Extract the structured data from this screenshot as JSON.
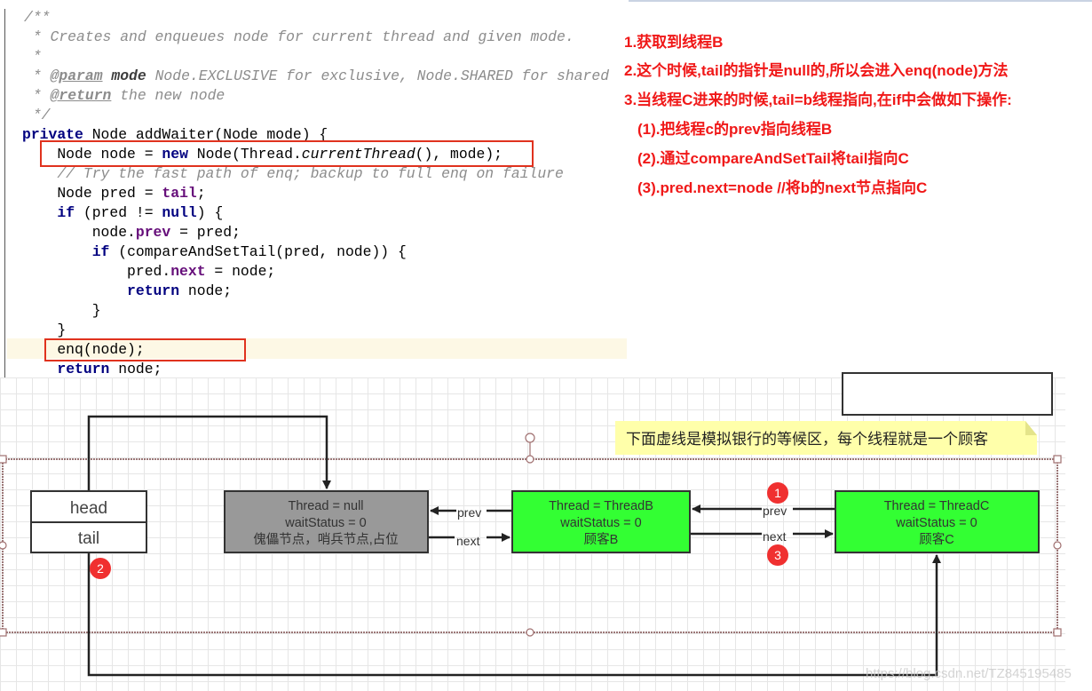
{
  "code": {
    "lines": [
      [
        [
          "/**",
          "cm"
        ]
      ],
      [
        [
          " * Creates and enqueues node for current thread and given mode.",
          "cm"
        ]
      ],
      [
        [
          " *",
          "cm"
        ]
      ],
      [
        [
          " * ",
          "cm"
        ],
        [
          "@param",
          "tag"
        ],
        [
          " mode",
          "pn"
        ],
        [
          " Node.EXCLUSIVE for exclusive, Node.SHARED for shared",
          "cm"
        ]
      ],
      [
        [
          " * ",
          "cm"
        ],
        [
          "@return",
          "tag"
        ],
        [
          " the new node",
          "cm"
        ]
      ],
      [
        [
          " */",
          "cm"
        ]
      ],
      [
        [
          "private",
          "kw"
        ],
        [
          " Node addWaiter(Node mode) {",
          ""
        ]
      ],
      [
        [
          "    Node node = ",
          ""
        ],
        [
          "new",
          "kw"
        ],
        [
          " Node(Thread.",
          ""
        ],
        [
          "currentThread",
          "it"
        ],
        [
          "(), mode);",
          ""
        ]
      ],
      [
        [
          "    // Try the fast path of enq; backup to full enq on failure",
          "cm"
        ]
      ],
      [
        [
          "    Node pred = ",
          ""
        ],
        [
          "tail",
          "fld"
        ],
        [
          ";",
          ""
        ]
      ],
      [
        [
          "    ",
          ""
        ],
        [
          "if",
          "kw"
        ],
        [
          " (pred != ",
          ""
        ],
        [
          "null",
          "kw"
        ],
        [
          ") {",
          ""
        ]
      ],
      [
        [
          "        node.",
          ""
        ],
        [
          "prev",
          "fld"
        ],
        [
          " = pred;",
          ""
        ]
      ],
      [
        [
          "        ",
          ""
        ],
        [
          "if",
          "kw"
        ],
        [
          " (compareAndSetTail(pred, node)) {",
          ""
        ]
      ],
      [
        [
          "            pred.",
          ""
        ],
        [
          "next",
          "fld"
        ],
        [
          " = node;",
          ""
        ]
      ],
      [
        [
          "            ",
          ""
        ],
        [
          "return",
          "kw"
        ],
        [
          " node;",
          ""
        ]
      ],
      [
        [
          "        }",
          ""
        ]
      ],
      [
        [
          "    }",
          ""
        ]
      ],
      [
        [
          "    enq(node);",
          ""
        ]
      ],
      [
        [
          "    ",
          ""
        ],
        [
          "return",
          "kw"
        ],
        [
          " node;",
          ""
        ]
      ]
    ]
  },
  "notes": [
    "1.获取到线程B",
    "2.这个时候,tail的指针是null的,所以会进入enq(node)方法",
    "3.当线程C进来的时候,tail=b线程指向,在if中会做如下操作:",
    "(1).把线程c的prev指向线程B",
    "(2).通过compareAndSetTail将tail指向C",
    "(3).pred.next=node //将b的next节点指向C"
  ],
  "diagram": {
    "head_label": "head",
    "tail_label": "tail",
    "sentinel": {
      "l1": "Thread = null",
      "l2": "waitStatus = 0",
      "l3": "傀儡节点，哨兵节点,占位"
    },
    "nodeB": {
      "l1": "Thread = ThreadB",
      "l2": "waitStatus = 0",
      "l3": "顾客B"
    },
    "nodeC": {
      "l1": "Thread = ThreadC",
      "l2": "waitStatus = 0",
      "l3": "顾客C"
    },
    "prev_label": "prev",
    "next_label": "next",
    "note": "下面虚线是模拟银行的等候区，每个线程就是一个顾客",
    "badges": [
      "1",
      "2",
      "3"
    ],
    "colors": {
      "sentinel": "#999999",
      "active": "#33ff33",
      "badge": "#f03030",
      "note": "#ffffaa"
    }
  },
  "watermark": "https://blog.csdn.net/TZ845195485"
}
